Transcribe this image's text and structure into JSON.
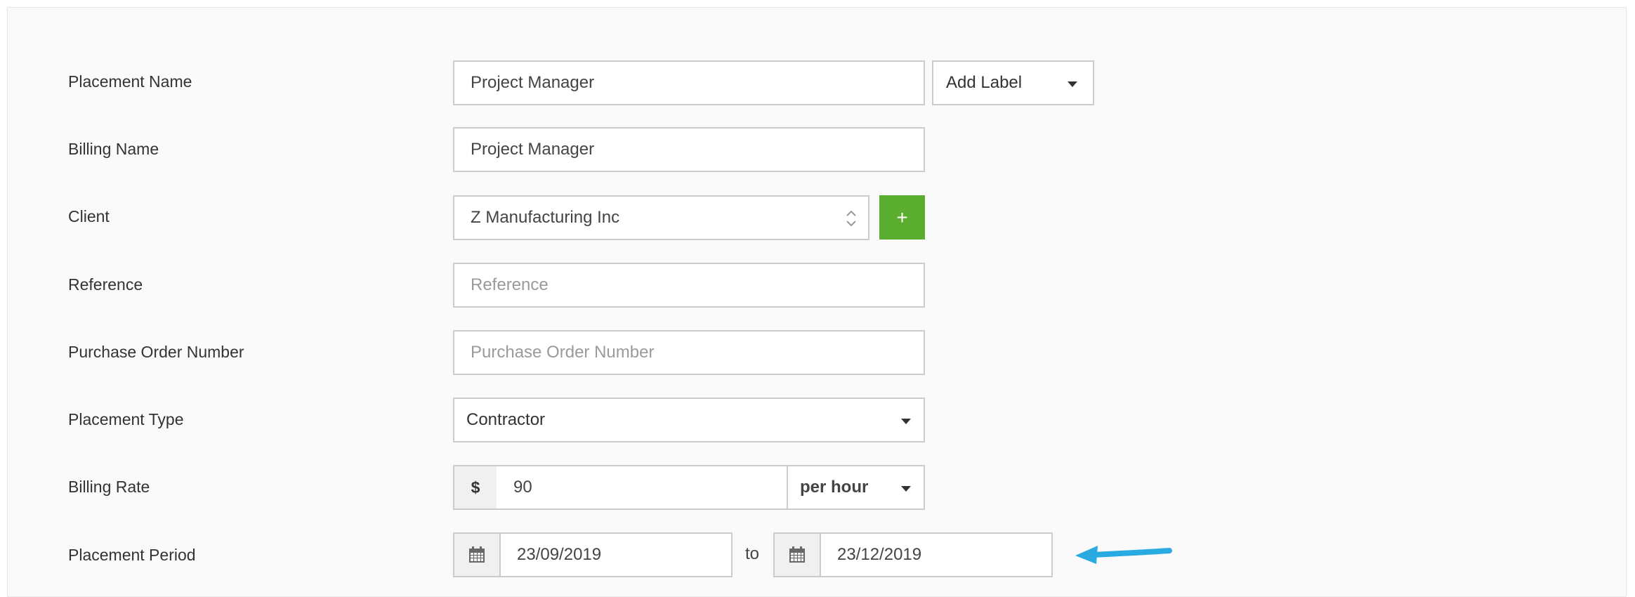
{
  "form": {
    "placement_name": {
      "label": "Placement Name",
      "value": "Project Manager",
      "add_label": "Add Label"
    },
    "billing_name": {
      "label": "Billing Name",
      "value": "Project Manager"
    },
    "client": {
      "label": "Client",
      "value": "Z Manufacturing Inc",
      "add_button": "+"
    },
    "reference": {
      "label": "Reference",
      "placeholder": "Reference"
    },
    "purchase_order": {
      "label": "Purchase Order Number",
      "placeholder": "Purchase Order Number"
    },
    "placement_type": {
      "label": "Placement Type",
      "value": "Contractor"
    },
    "billing_rate": {
      "label": "Billing Rate",
      "currency": "$",
      "value": "90",
      "unit": "per hour"
    },
    "placement_period": {
      "label": "Placement Period",
      "start": "23/09/2019",
      "separator": "to",
      "end": "23/12/2019"
    }
  },
  "icons": {
    "calendar": "calendar-icon",
    "caret": "chevron-down-icon",
    "updown": "up-down-arrows-icon",
    "arrow": "annotation-arrow-icon"
  },
  "colors": {
    "accent_green": "#5bad2f",
    "annotation_arrow": "#29abe2"
  }
}
